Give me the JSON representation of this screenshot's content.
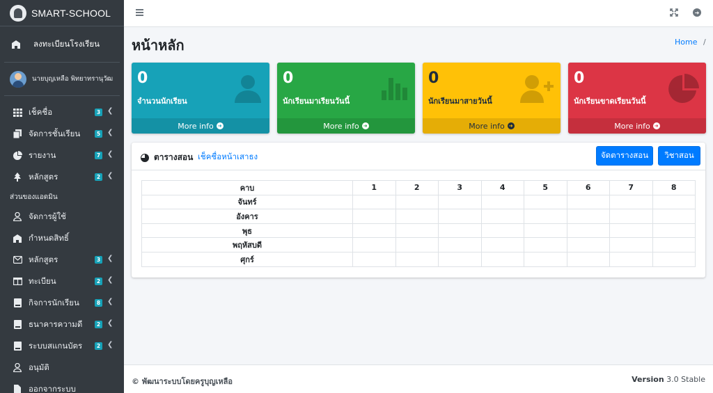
{
  "brand": {
    "name": "SMART-SCHOOL"
  },
  "sidebar": {
    "register_label": "ลงทะเบียนโรงเรียน",
    "user_name": "นายบุญเหลือ พิทยาทรานุวัฒ",
    "items": [
      {
        "label": "เช็คชื่อ",
        "badge": "3",
        "icon": "grid-icon"
      },
      {
        "label": "จัดการชั้นเรียน",
        "badge": "5",
        "icon": "copy-icon"
      },
      {
        "label": "รายงาน",
        "badge": "7",
        "icon": "chart-pie-icon"
      },
      {
        "label": "หลักสูตร",
        "badge": "2",
        "icon": "tree-icon"
      }
    ],
    "admin_header": "ส่วนของแอดมิน",
    "admin_items": [
      {
        "label": "จัดการผู้ใช้",
        "badge": "",
        "icon": "user-icon"
      },
      {
        "label": "กำหนดสิทธิ์",
        "badge": "",
        "icon": "school-icon"
      },
      {
        "label": "หลักสูตร",
        "badge": "3",
        "icon": "envelope-icon"
      },
      {
        "label": "ทะเบียน",
        "badge": "2",
        "icon": "columns-icon"
      },
      {
        "label": "กิจการนักเรียน",
        "badge": "8",
        "icon": "book-icon"
      },
      {
        "label": "ธนาคารความดี",
        "badge": "2",
        "icon": "book-icon"
      },
      {
        "label": "ระบบสแกนบัตร",
        "badge": "2",
        "icon": "book-icon"
      },
      {
        "label": "อนุมัติ",
        "badge": "",
        "icon": "user-icon"
      },
      {
        "label": "ออกจากระบบ",
        "badge": "",
        "icon": "file-icon"
      }
    ]
  },
  "header": {
    "page_title": "หน้าหลัก",
    "breadcrumb_home": "Home",
    "breadcrumb_sep": "/"
  },
  "stats": [
    {
      "value": "0",
      "label": "จำนวนนักเรียน",
      "more": "More info",
      "color": "#17a2b8",
      "icon": "user-icon"
    },
    {
      "value": "0",
      "label": "นักเรียนมาเรียนวันนี้",
      "more": "More info",
      "color": "#28a745",
      "icon": "bar-chart-icon"
    },
    {
      "value": "0",
      "label": "นักเรียนมาสายวันนี้",
      "more": "More info",
      "color": "#ffc107",
      "icon": "user-plus-icon"
    },
    {
      "value": "0",
      "label": "นักเรียนขาดเรียนวันนี้",
      "more": "More info",
      "color": "#dc3545",
      "icon": "pie-chart-icon"
    }
  ],
  "schedule": {
    "title": "ตารางสอน",
    "link": "เช็คชื่อหน้าเสาธง",
    "btn_manage": "จัดตารางสอน",
    "btn_subject": "วิชาสอน",
    "headers": [
      "คาบ",
      "1",
      "2",
      "3",
      "4",
      "5",
      "6",
      "7",
      "8"
    ],
    "days": [
      "จันทร์",
      "อังคาร",
      "พุธ",
      "พฤหัสบดี",
      "ศุกร์"
    ]
  },
  "footer": {
    "credit": "© พัฒนาระบบโดยครูบุญเหลือ",
    "version_label": "Version",
    "version_value": "3.0 Stable"
  }
}
